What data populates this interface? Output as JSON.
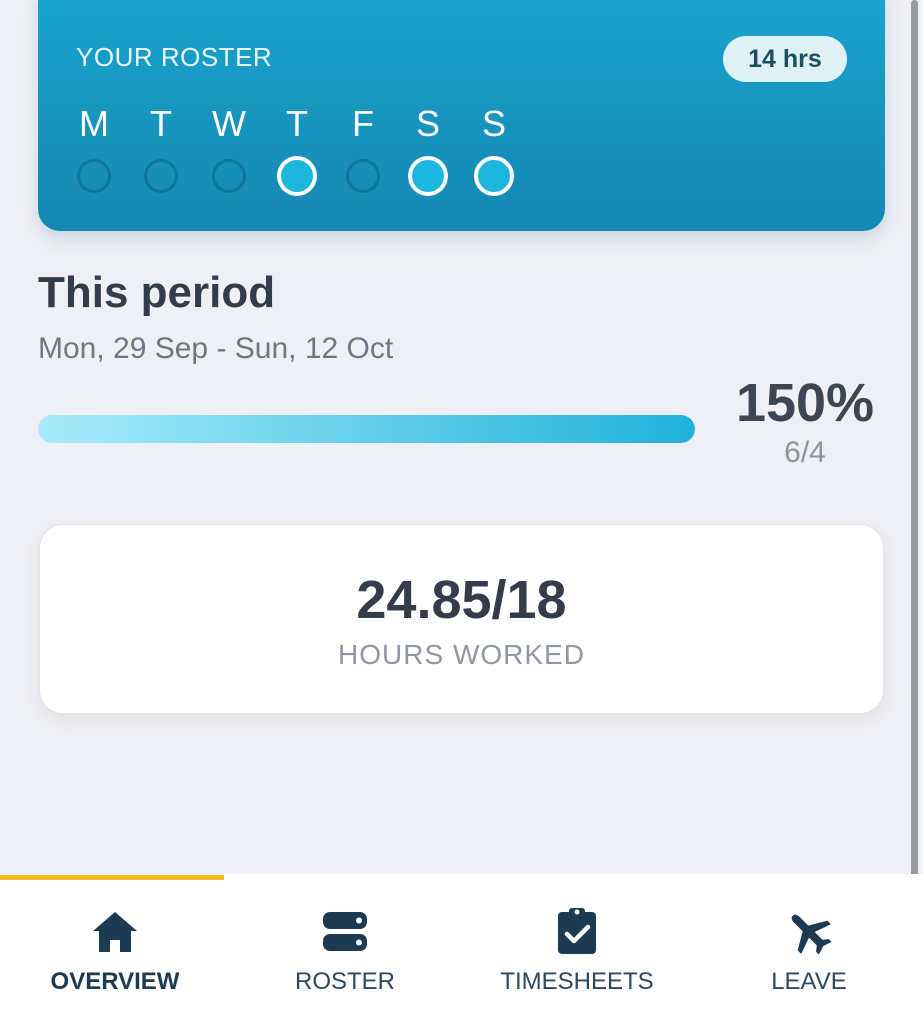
{
  "roster": {
    "title": "YOUR ROSTER",
    "hours_badge": "14 hrs",
    "days": [
      {
        "letter": "M",
        "active": false
      },
      {
        "letter": "T",
        "active": false
      },
      {
        "letter": "W",
        "active": false
      },
      {
        "letter": "T",
        "active": true
      },
      {
        "letter": "F",
        "active": false
      },
      {
        "letter": "S",
        "active": true
      },
      {
        "letter": "S",
        "active": true
      }
    ]
  },
  "period": {
    "title": "This period",
    "dates": "Mon, 29 Sep - Sun, 12 Oct",
    "percent": "150%",
    "ratio": "6/4",
    "progress_fill_fraction": 1.0
  },
  "hours": {
    "value": "24.85/18",
    "label": "HOURS WORKED"
  },
  "nav": {
    "items": [
      {
        "label": "OVERVIEW",
        "icon": "home-icon",
        "active": true
      },
      {
        "label": "ROSTER",
        "icon": "server-icon",
        "active": false
      },
      {
        "label": "TIMESHEETS",
        "icon": "clipboard-check-icon",
        "active": false
      },
      {
        "label": "LEAVE",
        "icon": "airplane-icon",
        "active": false
      }
    ]
  },
  "colors": {
    "accent": "#1aa6cf",
    "indicator": "#f4bb25",
    "nav_text": "#1c3b52"
  }
}
